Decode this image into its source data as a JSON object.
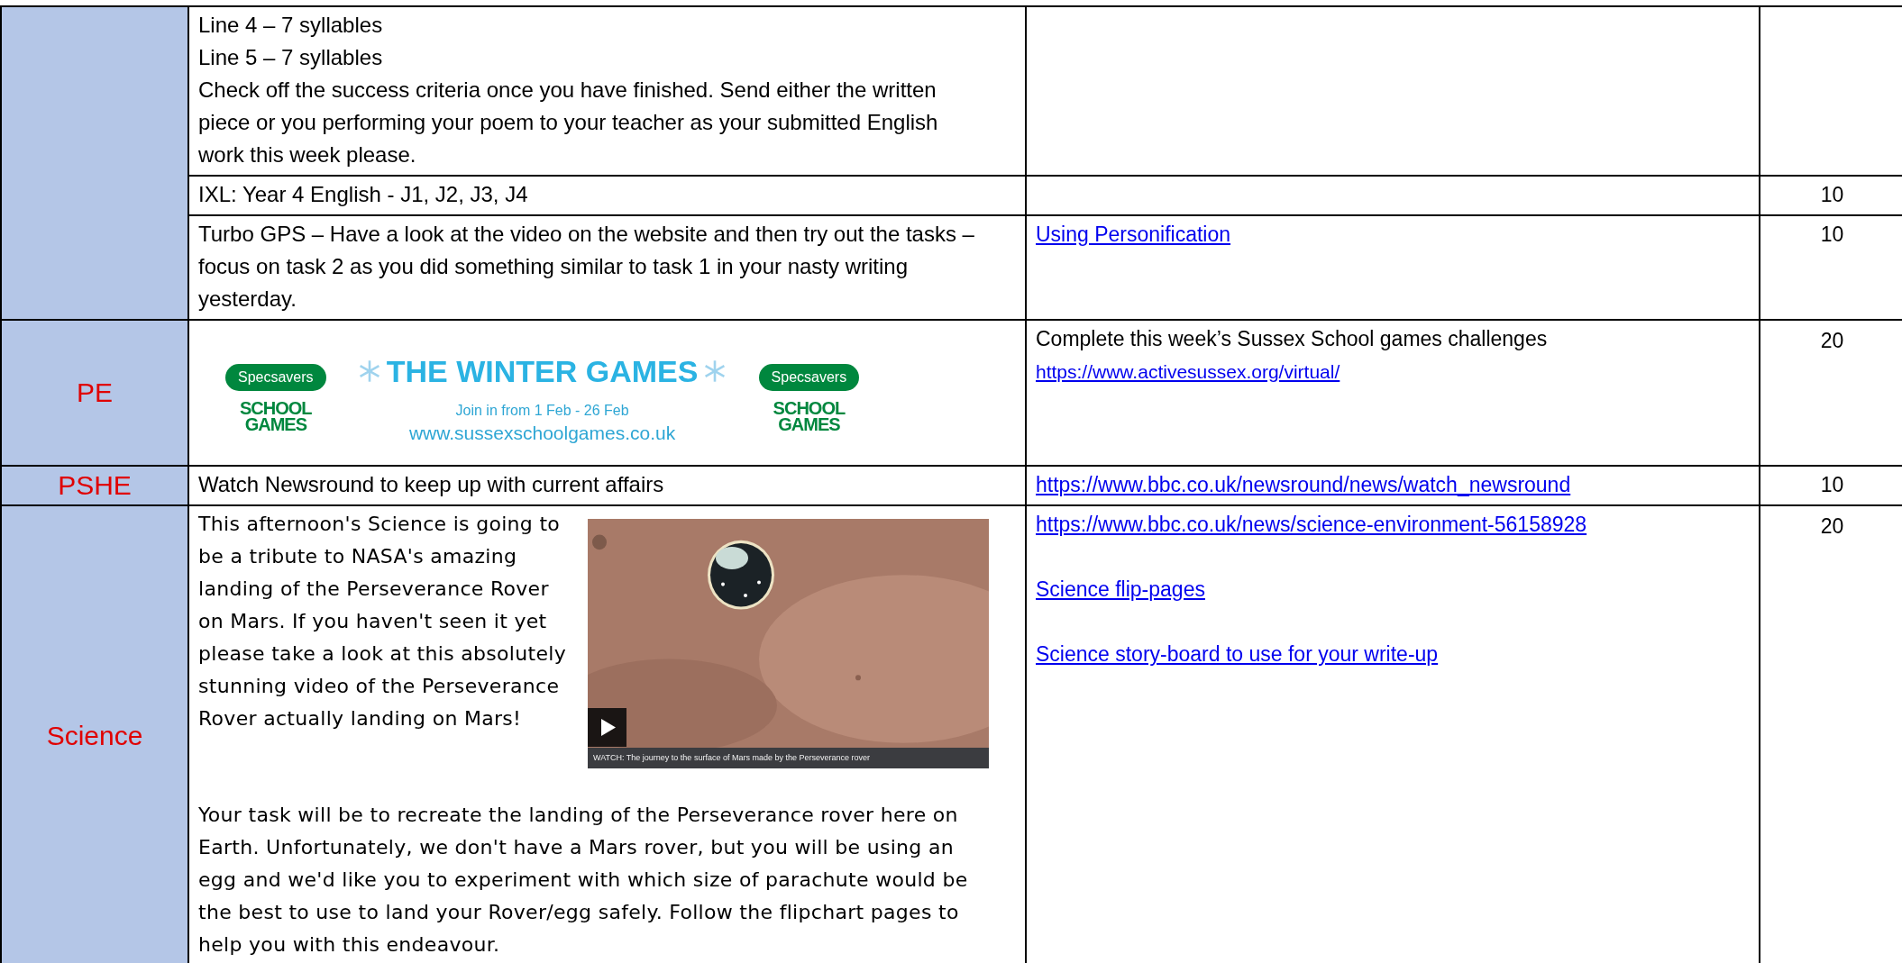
{
  "rows": [
    {
      "kind": "text",
      "subject": "",
      "task_lines": [
        "Line 4 – 7 syllables",
        "Line 5 – 7 syllables",
        "Check off the success criteria once you have finished. Send either the written piece or you performing your poem to your teacher as your submitted English work this week please."
      ],
      "resources": [],
      "minutes": ""
    },
    {
      "kind": "text",
      "subject": "",
      "task_lines": [
        "IXL: Year 4 English -  J1, J2, J3, J4"
      ],
      "resources": [],
      "minutes": "10"
    },
    {
      "kind": "text",
      "subject": "",
      "task_lines": [
        "Turbo GPS – Have a look at the video on the website and then try out the tasks – focus on task 2 as you did something similar to task 1 in your nasty writing yesterday."
      ],
      "resources": [
        {
          "kind": "link",
          "text": "Using Personification"
        }
      ],
      "minutes": "10"
    },
    {
      "kind": "banner",
      "subject": "PE",
      "banner": {
        "logos": [
          {
            "sponsor": "Specsavers",
            "logo_top": "SCHOOL",
            "logo_bottom": "GAMES"
          },
          {
            "sponsor": "Specsavers",
            "logo_top": "SCHOOL",
            "logo_bottom": "GAMES"
          }
        ],
        "title": "THE WINTER GAMES",
        "dates": "Join in from 1 Feb - 26 Feb",
        "website": "www.sussexschoolgames.co.uk"
      },
      "resources": [
        {
          "kind": "text",
          "text": "Complete this week’s Sussex School games challenges"
        },
        {
          "kind": "link",
          "text": "https://www.activesussex.org/virtual/"
        }
      ],
      "minutes": "20"
    },
    {
      "kind": "text",
      "subject": "PSHE",
      "task_lines": [
        "Watch Newsround to keep up with current affairs"
      ],
      "resources": [
        {
          "kind": "link",
          "text": "https://www.bbc.co.uk/newsround/news/watch_newsround"
        }
      ],
      "minutes": "10"
    },
    {
      "kind": "video",
      "subject": "Science",
      "intro": "This afternoon's Science is going to be a tribute to NASA's amazing landing of the Perseverance Rover on Mars. If you haven't seen it yet please take a look at this absolutely stunning video of the Perseverance Rover actually landing on Mars!",
      "video": {
        "caption": "WATCH: The journey to the surface of Mars made by the Perseverance rover"
      },
      "body": "Your task will be to recreate the landing of the Perseverance rover here on Earth. Unfortunately, we don't have a Mars rover, but you will be using an egg and we'd like you to experiment with which size of parachute would be the best to use to land your Rover/egg safely. Follow the flipchart pages to help you with this endeavour.",
      "resources": [
        {
          "kind": "link",
          "text": "https://www.bbc.co.uk/news/science-environment-56158928"
        },
        {
          "kind": "link",
          "text": "Science flip-pages"
        },
        {
          "kind": "link",
          "text": "Science story-board to use for your write-up"
        }
      ],
      "minutes": "20"
    }
  ]
}
